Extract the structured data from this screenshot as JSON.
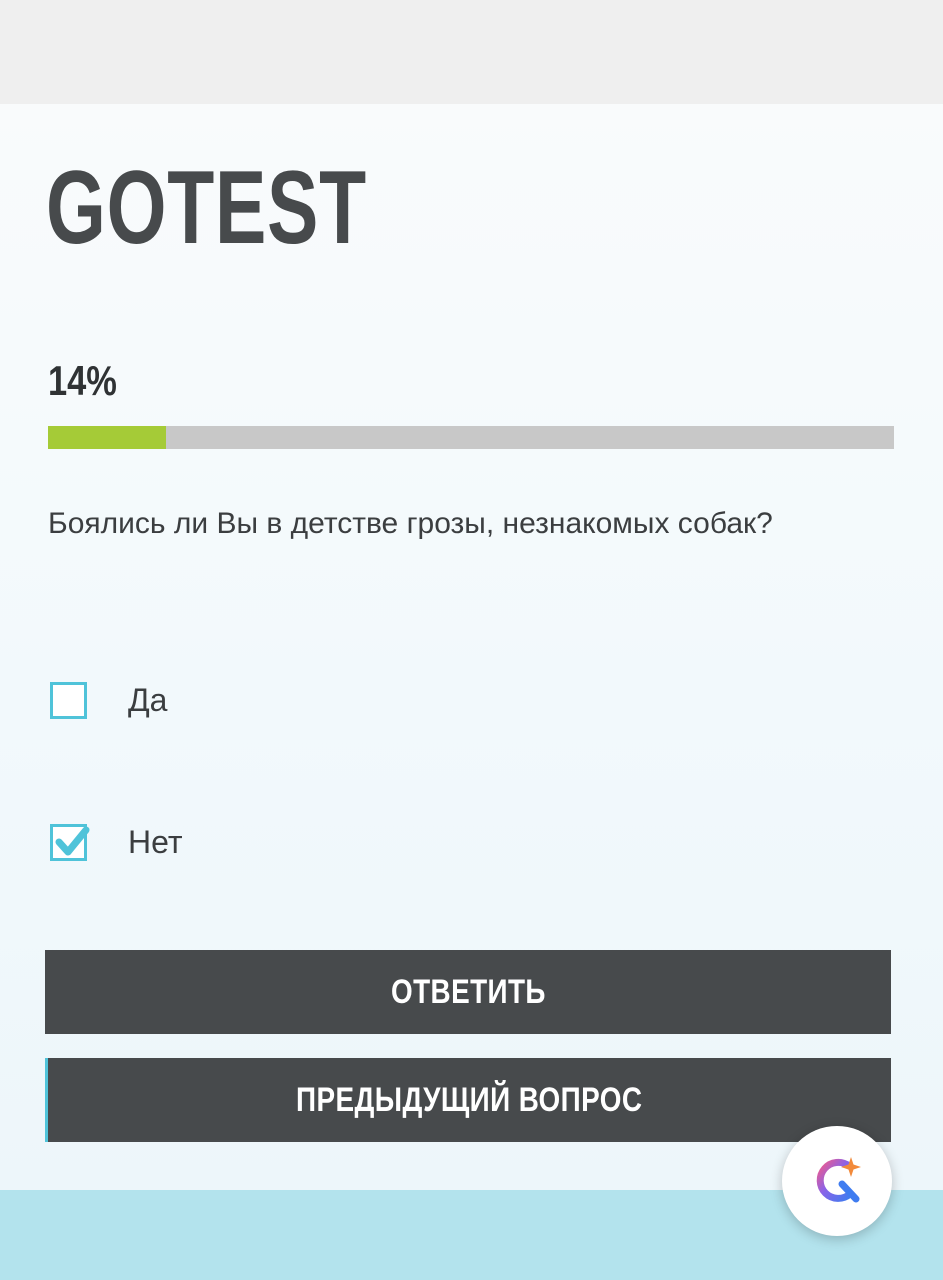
{
  "brand": {
    "logo_text": "GOTEST"
  },
  "progress": {
    "label": "14%",
    "value_percent": 14
  },
  "question": {
    "text": "Боялись ли Вы в детстве грозы, незнакомых собак?"
  },
  "options": [
    {
      "label": "Да",
      "checked": false
    },
    {
      "label": "Нет",
      "checked": true
    }
  ],
  "buttons": {
    "answer_label": "ОТВЕТИТЬ",
    "previous_label": "ПРЕДЫДУЩИЙ ВОПРОС"
  },
  "assistant": {
    "icon": "search-assistant-icon"
  },
  "colors": {
    "progress_fill": "#a5cb37",
    "progress_track": "#c8c8c8",
    "checkbox_accent": "#4fc3d9",
    "button_background": "#474a4c",
    "footer_band": "#b3e3ed"
  }
}
